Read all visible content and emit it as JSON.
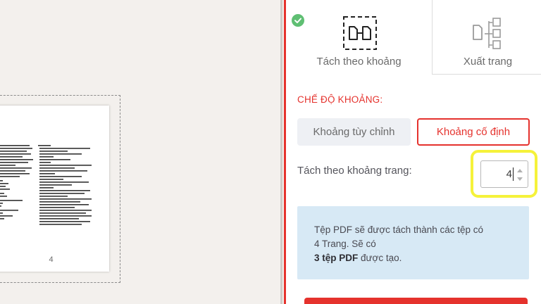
{
  "preview": {
    "page_number": "4"
  },
  "tabs": {
    "range_label": "Tách theo khoảng",
    "extract_label": "Xuất trang",
    "active": "range",
    "check_icon": "check-circle-icon"
  },
  "mode": {
    "section_label": "CHẾ ĐỘ KHOẢNG:",
    "custom_label": "Khoảng tùy chỉnh",
    "fixed_label": "Khoảng cố định",
    "selected": "fixed"
  },
  "range": {
    "label": "Tách theo khoảng trang:",
    "value": "4"
  },
  "info": {
    "line1": "Tệp PDF sẽ được tách thành các tệp có",
    "line2": "4 Trang. Sẽ có",
    "bold": "3 tệp PDF",
    "line3_rest": " được tạo."
  },
  "colors": {
    "accent": "#e5322d",
    "highlight": "#f5f23a",
    "info_bg": "#d7e9f5",
    "check": "#5fbf73"
  }
}
